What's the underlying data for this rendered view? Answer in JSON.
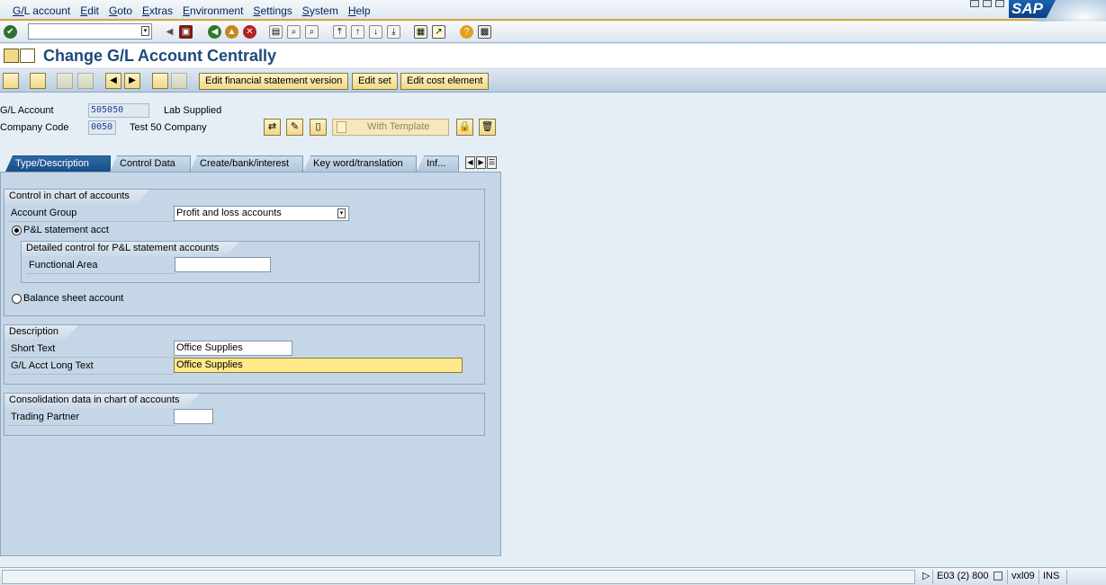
{
  "menu": [
    "G/L account",
    "Edit",
    "Goto",
    "Extras",
    "Environment",
    "Settings",
    "System",
    "Help"
  ],
  "brand": {
    "logo_text": "SAP",
    "accent": "#d9a441"
  },
  "command_field": {
    "value": ""
  },
  "title": "Change G/L Account Centrally",
  "app_toolbar": {
    "edit_fs_version": "Edit financial statement version",
    "edit_set": "Edit set",
    "edit_cost_element": "Edit cost element"
  },
  "header": {
    "gl_account_label": "G/L Account",
    "gl_account_value": "505050",
    "gl_account_desc": "Lab Supplied",
    "company_code_label": "Company Code",
    "company_code_value": "0050",
    "company_code_desc": "Test 50 Company",
    "with_template": "With Template"
  },
  "tabs": [
    "Type/Description",
    "Control Data",
    "Create/bank/interest",
    "Key word/translation",
    "Inf..."
  ],
  "active_tab": 0,
  "control_group": {
    "title": "Control in chart of accounts",
    "account_group_label": "Account Group",
    "account_group_value": "Profit and loss accounts",
    "pl_radio": "P&L statement acct",
    "detail_group_title": "Detailed control for P&L statement accounts",
    "functional_area_label": "Functional Area",
    "functional_area_value": "",
    "bs_radio": "Balance sheet account",
    "selected": "pl"
  },
  "description_group": {
    "title": "Description",
    "short_text_label": "Short Text",
    "short_text_value": "Office Supplies",
    "long_text_label": "G/L Acct Long Text",
    "long_text_value": "Office Supplies"
  },
  "consolidation_group": {
    "title": "Consolidation data in chart of accounts",
    "trading_partner_label": "Trading Partner",
    "trading_partner_value": ""
  },
  "status": {
    "system": "E03 (2) 800",
    "host": "vxl09",
    "mode": "INS"
  }
}
